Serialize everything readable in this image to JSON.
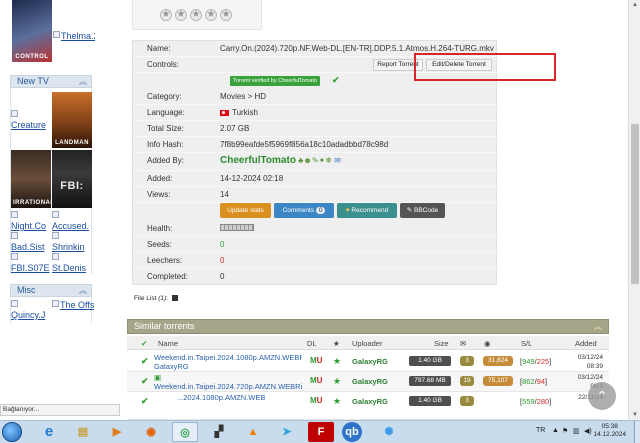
{
  "sidebar": {
    "top_items": [
      {
        "title": "CONTROL",
        "alt": "Thelma.2"
      }
    ],
    "new_tv": {
      "heading": "New TV",
      "items": [
        {
          "alt": "Creature"
        },
        {
          "title": "LANDMAN"
        },
        {
          "title": "IRRATIONAL"
        },
        {
          "title": "FBI:"
        },
        {
          "alt": "Night.Co"
        },
        {
          "alt": "Accused."
        },
        {
          "alt": "Bad.Sist"
        },
        {
          "alt": "Shrinkin"
        },
        {
          "alt": "FBI.S07E"
        },
        {
          "alt": "St.Denis"
        }
      ]
    },
    "misc": {
      "heading": "Misc",
      "items": [
        {
          "alt": "Quincy.J"
        },
        {
          "alt": "The Offs"
        }
      ]
    }
  },
  "rating": {
    "stars": 5,
    "filled": 0
  },
  "details": {
    "name_label": "Name:",
    "name_value": "Carry.On.(2024).720p.NF.Web-DL.[EN-TR].DDP.5.1.Atmos.H.264-TURG.mkv",
    "controls_label": "Controls:",
    "report_button": "Report Torrent",
    "edit_button": "Edit/Delete Torrent",
    "verified_badge": "Torrent verified by CheerfulTomato",
    "category_label": "Category:",
    "category_value": "Movies > HD",
    "language_label": "Language:",
    "language_value": "Turkish",
    "total_size_label": "Total Size:",
    "total_size_value": "2.07 GB",
    "info_hash_label": "Info Hash:",
    "info_hash_value": "7f8b99eafde5f5969f856a18c10adadbbd78c98d",
    "added_by_label": "Added By:",
    "added_by_value": "CheerfulTomato",
    "added_label": "Added:",
    "added_value": "14-12-2024 02:18",
    "views_label": "Views:",
    "views_value": "14",
    "update_stats_button": "Update stats",
    "comments_button": "Comments",
    "comments_count": "0",
    "recommend_button": "Recommend",
    "bbcode_button": "BBCode",
    "health_label": "Health:",
    "seeds_label": "Seeds:",
    "seeds_value": "0",
    "leechers_label": "Leechers:",
    "leechers_value": "0",
    "completed_label": "Completed:",
    "completed_value": "0"
  },
  "file_list": {
    "label": "File List",
    "count": "(1)"
  },
  "similar": {
    "heading": "Similar torrents",
    "columns": {
      "name": "Name",
      "dl": "DL",
      "uploader": "Uploader",
      "size": "Size",
      "sl": "S/L",
      "added": "Added"
    },
    "rows": [
      {
        "name": "Weekend.in.Taipei.2024.1080p.AMZN.WEBRip.1400MB.DD5.1.x264-GalaxyRG",
        "uploader": "GalaxyRG",
        "size": "1.40 GB",
        "comments": "3",
        "views": "31,824",
        "seeds": "949",
        "leechers": "225",
        "date": "03/12/24",
        "time": "08:39"
      },
      {
        "name": "Weekend.in.Taipei.2024.720p.AMZN.WEBRip.800MB.x264-GalaxyRG",
        "uploader": "GalaxyRG",
        "size": "797.68 MB",
        "comments": "19",
        "views": "75,107",
        "seeds": "862",
        "leechers": "94",
        "date": "03/12/24",
        "time": "06:3"
      },
      {
        "name": "...2024.1080p.AMZN.WEB",
        "uploader": "GalaxyRG",
        "size": "1.40 GB",
        "comments": "3",
        "views": "",
        "seeds": "559",
        "leechers": "280",
        "date": "22/11/24",
        "time": ""
      }
    ]
  },
  "status_bar": {
    "text": "Bağlanıyor..."
  },
  "taskbar": {
    "language": "TR",
    "time": "05:38",
    "date": "14.12.2024"
  },
  "colors": {
    "link": "#3b73b9",
    "verified": "#3aa23a",
    "highlight_box": "#d8262a",
    "update_stats": "#d9901f",
    "comments": "#3c86c6",
    "recommend": "#3c8f8f",
    "bbcode": "#555555",
    "similar_header": "#a6a58a"
  }
}
